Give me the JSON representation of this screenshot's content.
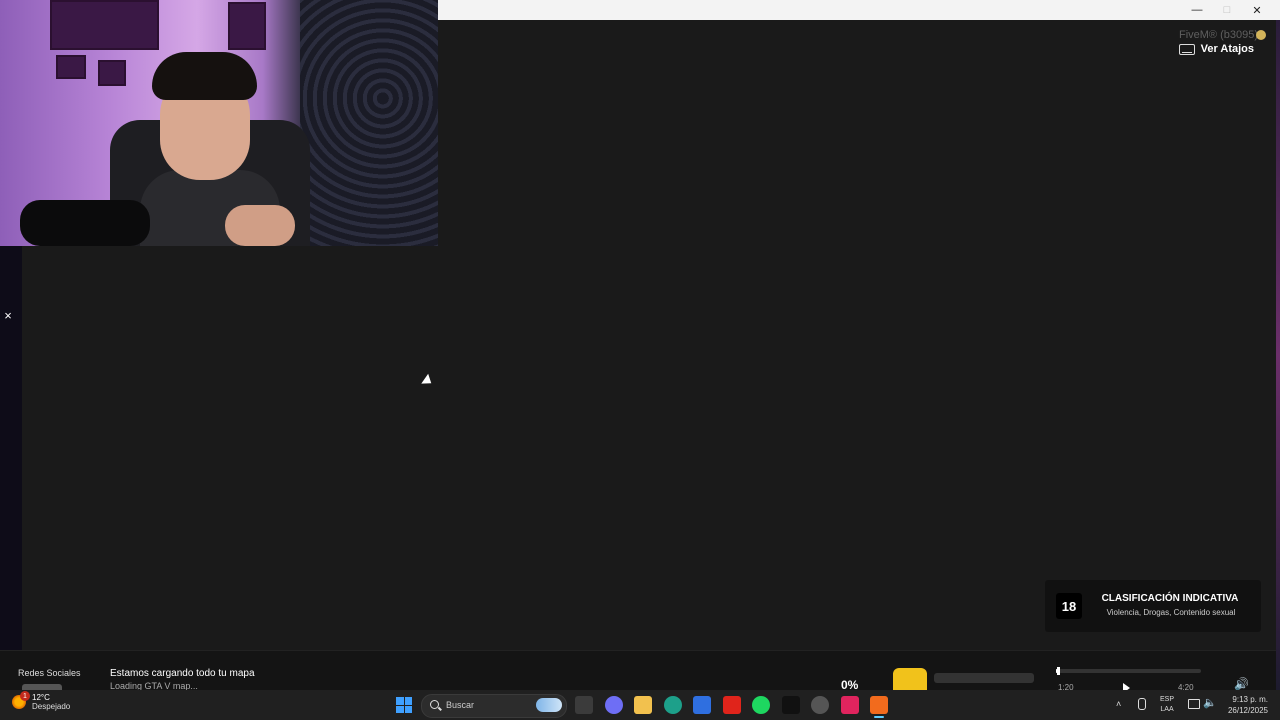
{
  "game": {
    "version_text": "FiveM® (b3095)",
    "shortcuts_label": "Ver Atajos",
    "side_close_glyph": "×"
  },
  "window_controls": {
    "minimize": "—",
    "maximize": "□",
    "close": "✕"
  },
  "rating": {
    "number": "18",
    "title": "CLASIFICACIÓN INDICATIVA",
    "description": "Violencia, Drogas, Contenido sexual"
  },
  "loader": {
    "social_label": "Redes Sociales",
    "title": "Estamos cargando todo tu mapa",
    "subtitle": "Loading GTA V map...",
    "progress_label": "0%",
    "progress": 0.0,
    "music": {
      "elapsed": "1:20",
      "total": "4:20",
      "position": 0.01
    },
    "volume_icon": "🔊",
    "accent_color": "#f1c21b"
  },
  "taskbar": {
    "weather": {
      "temperature": "12°C",
      "condition": "Despejado",
      "badge": "1"
    },
    "search_placeholder": "Buscar",
    "apps": [
      {
        "name": "file-manager-icon",
        "color": "#3b3b3b"
      },
      {
        "name": "copilot-icon",
        "color": "#6e6ef5"
      },
      {
        "name": "folder-icon",
        "color": "#f2c14e"
      },
      {
        "name": "edge-icon",
        "color": "#1da08a"
      },
      {
        "name": "store-icon",
        "color": "#2f6fe0"
      },
      {
        "name": "youtube-icon",
        "color": "#e0241b"
      },
      {
        "name": "spotify-icon",
        "color": "#1ed760"
      },
      {
        "name": "tiktok-icon",
        "color": "#111111"
      },
      {
        "name": "app-icon",
        "color": "#555555"
      },
      {
        "name": "tiktok-studio-icon",
        "color": "#e0245e"
      },
      {
        "name": "fivem-icon",
        "color": "#f26b1d"
      }
    ],
    "tray": {
      "chevron": "˄",
      "volume": "🔈",
      "lang_line1": "ESP",
      "lang_line2": "LAA",
      "time": "9:13 p. m.",
      "date": "26/12/2025"
    }
  }
}
